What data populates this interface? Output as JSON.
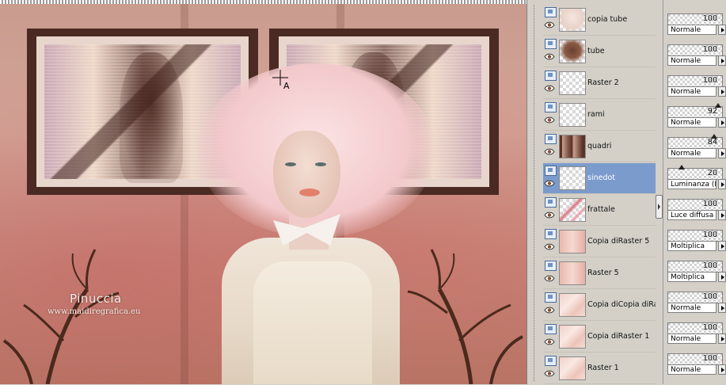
{
  "canvas": {
    "watermark_name": "Pinuccia",
    "watermark_url": "www.maidiregrafica.eu"
  },
  "layers": [
    {
      "name": "copia tube",
      "thumb": "tube-light",
      "opacity": "100",
      "blend": "Normale",
      "selected": false
    },
    {
      "name": "tube",
      "thumb": "tube-dark",
      "opacity": "100",
      "blend": "Normale",
      "selected": false
    },
    {
      "name": "Raster 2",
      "thumb": "transparent",
      "opacity": "100",
      "blend": "Normale",
      "selected": false
    },
    {
      "name": "rami",
      "thumb": "transparent",
      "opacity": "92",
      "blend": "Normale",
      "selected": false
    },
    {
      "name": "quadri",
      "thumb": "frames",
      "opacity": "84",
      "blend": "Normale",
      "selected": false
    },
    {
      "name": "sinedot",
      "thumb": "transparent",
      "opacity": "20",
      "blend": "Luminanza (L)",
      "selected": true
    },
    {
      "name": "frattale",
      "thumb": "fractal",
      "opacity": "100",
      "blend": "Luce diffusa",
      "selected": false
    },
    {
      "name": "Copia diRaster 5",
      "thumb": "pink",
      "opacity": "100",
      "blend": "Moltiplica",
      "selected": false
    },
    {
      "name": "Raster 5",
      "thumb": "pink",
      "opacity": "100",
      "blend": "Moltiplica",
      "selected": false
    },
    {
      "name": "Copia diCopia diRaster",
      "thumb": "pink-soft",
      "opacity": "100",
      "blend": "Normale",
      "selected": false
    },
    {
      "name": "Copia diRaster 1",
      "thumb": "pink-soft",
      "opacity": "100",
      "blend": "Normale",
      "selected": false
    },
    {
      "name": "Raster 1",
      "thumb": "pink-soft",
      "opacity": "100",
      "blend": "Normale",
      "selected": false
    }
  ],
  "colors": {
    "selection": "#7b9bcd",
    "panel": "#d4d0c8"
  }
}
